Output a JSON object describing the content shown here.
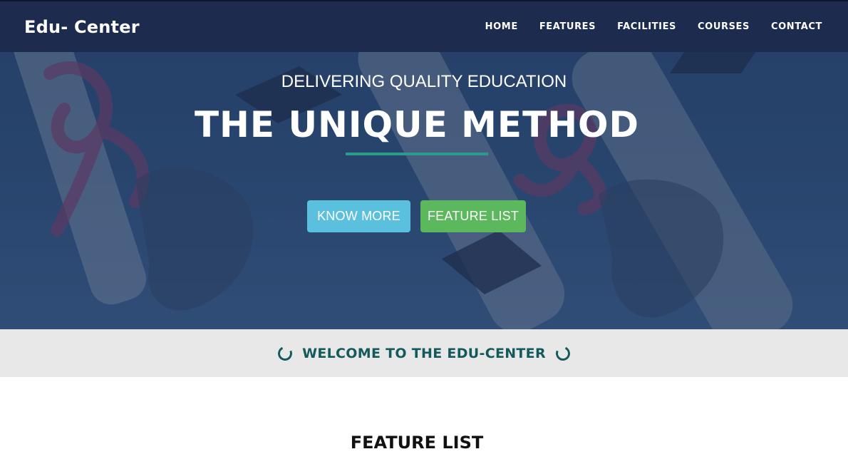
{
  "brand": "Edu- Center",
  "nav": {
    "items": [
      {
        "label": "HOME"
      },
      {
        "label": "FEATURES"
      },
      {
        "label": "FACILITIES"
      },
      {
        "label": "COURSES"
      },
      {
        "label": "CONTACT"
      }
    ]
  },
  "hero": {
    "subtitle": "DELIVERING QUALITY EDUCATION",
    "title": "THE UNIQUE METHOD",
    "buttons": {
      "know_more": "KNOW MORE",
      "feature_list": "FEATURE LIST"
    }
  },
  "welcome": {
    "text": "WELCOME TO THE EDU-CENTER",
    "icon": "circle-notch-icon"
  },
  "features": {
    "heading": "FEATURE LIST"
  },
  "colors": {
    "navbar": "#1d2b4f",
    "accent_teal": "#2c9a8c",
    "btn_info": "#5bc0de",
    "btn_success": "#5cb85c",
    "welcome_text": "#145a5a",
    "welcome_band": "#e8e8e8"
  }
}
